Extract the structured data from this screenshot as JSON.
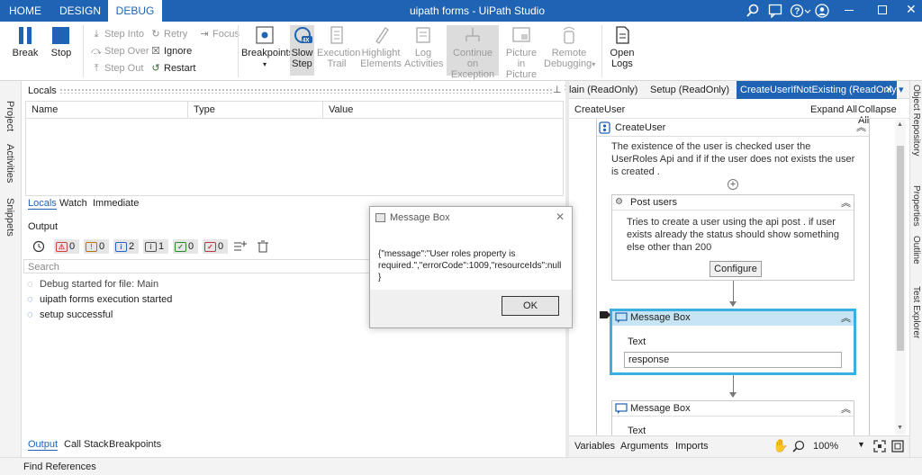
{
  "app": {
    "title": "uipath forms - UiPath Studio"
  },
  "tabs": [
    "HOME",
    "DESIGN",
    "DEBUG"
  ],
  "ribbon": {
    "break": "Break",
    "stop": "Stop",
    "step_into": "Step Into",
    "step_over": "Step Over",
    "step_out": "Step Out",
    "retry": "Retry",
    "ignore": "Ignore",
    "restart": "Restart",
    "focus": "Focus",
    "breakpoints": "Breakpoints",
    "slow_step_1": "Slow",
    "slow_step_2": "Step",
    "exec_trail_1": "Execution",
    "exec_trail_2": "Trail",
    "highlight_1": "Highlight",
    "highlight_2": "Elements",
    "log_1": "Log",
    "log_2": "Activities",
    "continue_1": "Continue on",
    "continue_2": "Exception",
    "pip_1": "Picture in",
    "pip_2": "Picture",
    "remote_1": "Remote",
    "remote_2": "Debugging",
    "open_logs_1": "Open",
    "open_logs_2": "Logs",
    "speed_badge": "4X"
  },
  "left_bar": {
    "project": "Project",
    "activities": "Activities",
    "snippets": "Snippets"
  },
  "right_bar": {
    "object_repo": "Object Repository",
    "properties": "Properties",
    "outline": "Outline",
    "test_explorer": "Test Explorer"
  },
  "locals": {
    "title": "Locals",
    "columns": [
      "Name",
      "Type",
      "Value"
    ],
    "tabs": [
      "Locals",
      "Watch",
      "Immediate"
    ]
  },
  "output": {
    "title": "Output",
    "filters": [
      {
        "icon": "warning-icon",
        "count": "0",
        "color": "#d04040"
      },
      {
        "icon": "alert-icon",
        "count": "0",
        "color": "#c07000"
      },
      {
        "icon": "info-icon",
        "count": "2",
        "color": "#2b63c0"
      },
      {
        "icon": "trace-icon",
        "count": "1",
        "color": "#555555"
      },
      {
        "icon": "check-icon",
        "count": "0",
        "color": "#2a8a2a"
      },
      {
        "icon": "error-check-icon",
        "count": "0",
        "color": "#c0304a"
      }
    ],
    "search_placeholder": "Search",
    "lines": [
      "Debug started for file: Main",
      "uipath forms execution started",
      "setup successful"
    ],
    "bottom_tabs": [
      "Output",
      "Call Stack",
      "Breakpoints"
    ]
  },
  "status": {
    "find_refs": "Find References"
  },
  "doc_tabs": [
    "lain (ReadOnly)",
    "Setup (ReadOnly)",
    "CreateUserIfNotExisting (ReadOnly)"
  ],
  "designer": {
    "breadcrumb": "CreateUser",
    "expand_all": "Expand All",
    "collapse_all": "Collapse All",
    "seq_title": "CreateUser",
    "seq_desc": "The existence of the user is checked user the UserRoles Api and if if the user does not exists the user is created .",
    "post_title": "Post users",
    "post_desc": "Tries to create a user using the api post . if user exists already the status should show something else other than 200",
    "configure": "Configure",
    "msg1_title": "Message Box",
    "msg1_label": "Text",
    "msg1_value": "response",
    "msg2_title": "Message Box",
    "msg2_label": "Text",
    "bottom": {
      "variables": "Variables",
      "arguments": "Arguments",
      "imports": "Imports",
      "zoom": "100%"
    }
  },
  "dialog": {
    "title": "Message Box",
    "message": "{\"message\":\"User roles property is required.\",\"errorCode\":1009,\"resourceIds\":null}",
    "ok": "OK"
  },
  "colors": {
    "accent": "#1f63b4",
    "selected": "#3ab0e0"
  }
}
